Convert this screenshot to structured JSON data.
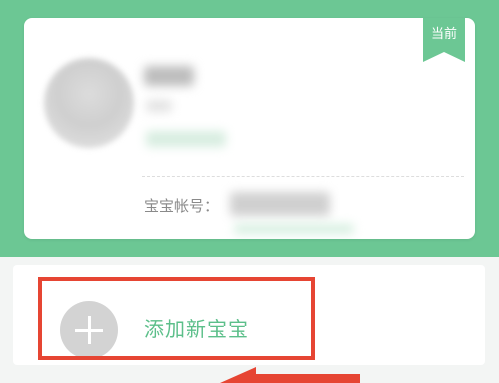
{
  "profile_card": {
    "current_tag": "当前",
    "account_label": "宝宝帐号："
  },
  "add_baby": {
    "label": "添加新宝宝"
  },
  "colors": {
    "header_green": "#6cc794",
    "accent_green": "#5cbf8a",
    "highlight_red": "#e64533"
  }
}
